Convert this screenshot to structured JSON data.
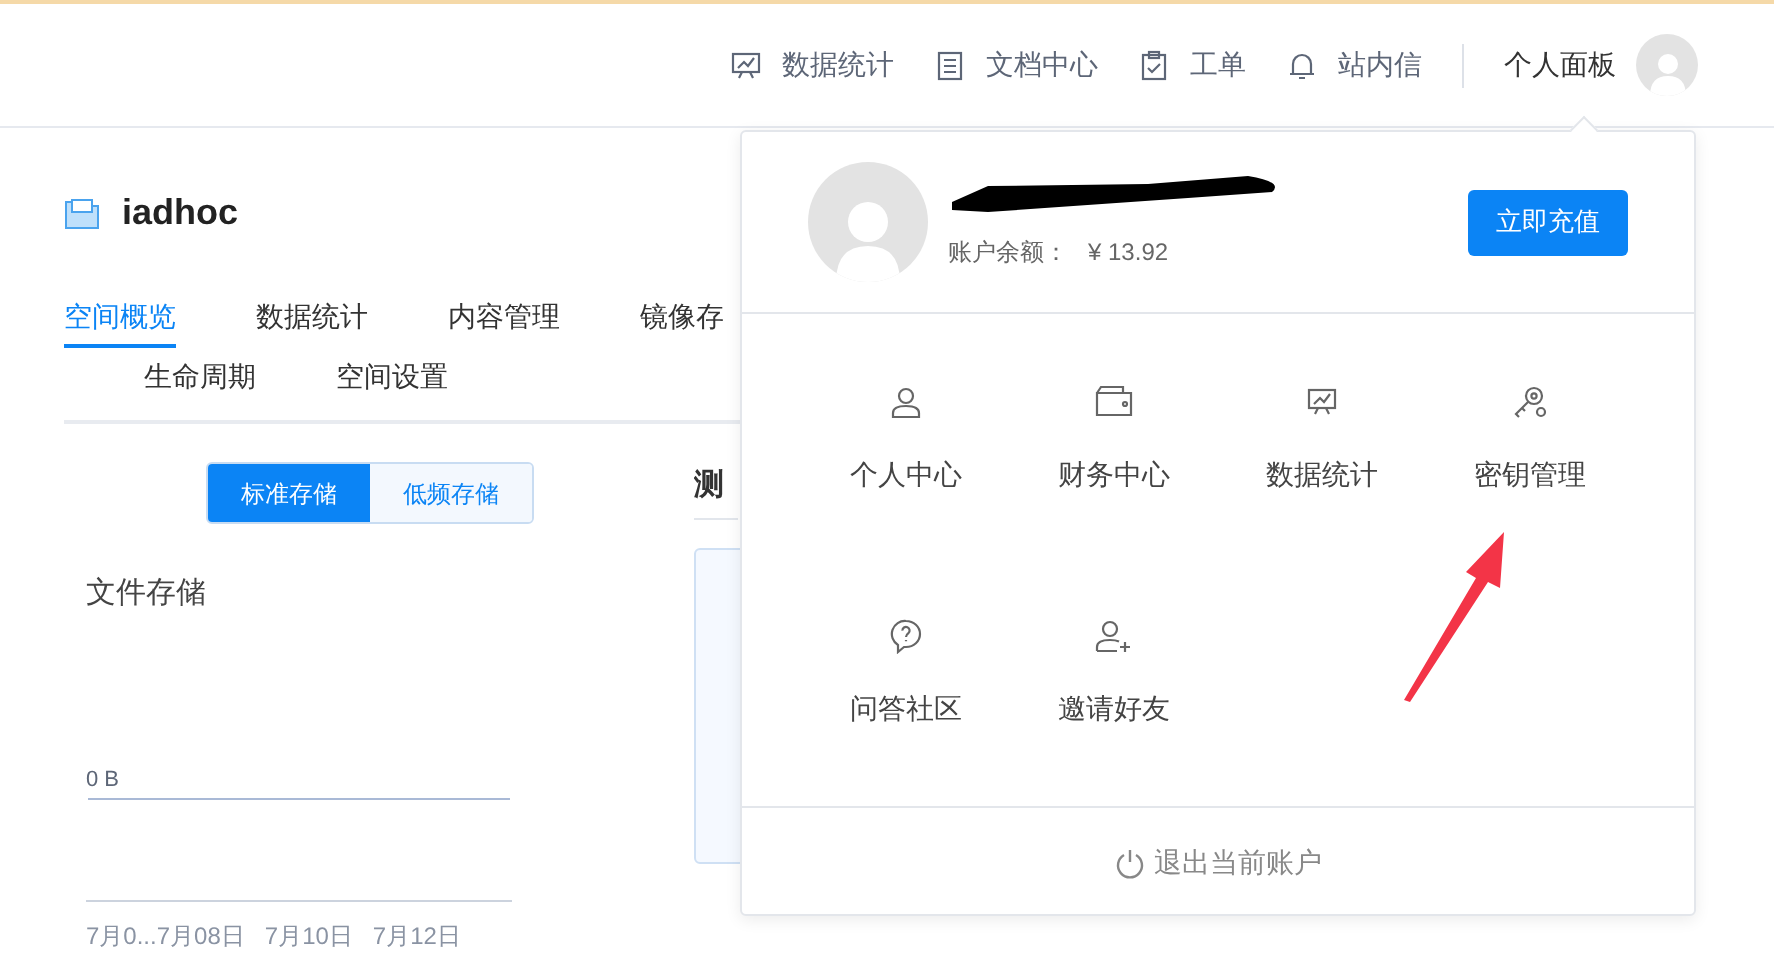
{
  "top_nav": {
    "items": [
      {
        "label": "数据统计"
      },
      {
        "label": "文档中心"
      },
      {
        "label": "工单"
      },
      {
        "label": "站内信"
      }
    ],
    "user_menu": "个人面板"
  },
  "bucket": {
    "name": "iadhoc"
  },
  "tabs": [
    {
      "label": "空间概览",
      "selected": true
    },
    {
      "label": "数据统计",
      "selected": false
    },
    {
      "label": "内容管理",
      "selected": false
    },
    {
      "label": "镜像存",
      "selected": false
    },
    {
      "label": "生命周期",
      "selected": false
    },
    {
      "label": "空间设置",
      "selected": false
    }
  ],
  "storage_toggle": [
    {
      "label": "标准存储",
      "selected": true
    },
    {
      "label": "低频存储",
      "selected": false
    }
  ],
  "file_storage": {
    "title": "文件存储",
    "y_label": "0 B",
    "x_labels": [
      "7月0...",
      "7月08日",
      "7月10日",
      "7月12日"
    ]
  },
  "side_panel": {
    "title": "测"
  },
  "popup": {
    "balance_label": "账户余额：",
    "balance": "¥ 13.92",
    "recharge_button": "立即充值",
    "items": [
      {
        "label": "个人中心"
      },
      {
        "label": "财务中心"
      },
      {
        "label": "数据统计"
      },
      {
        "label": "密钥管理"
      },
      {
        "label": "问答社区"
      },
      {
        "label": "邀请好友"
      }
    ],
    "logout": "退出当前账户"
  }
}
